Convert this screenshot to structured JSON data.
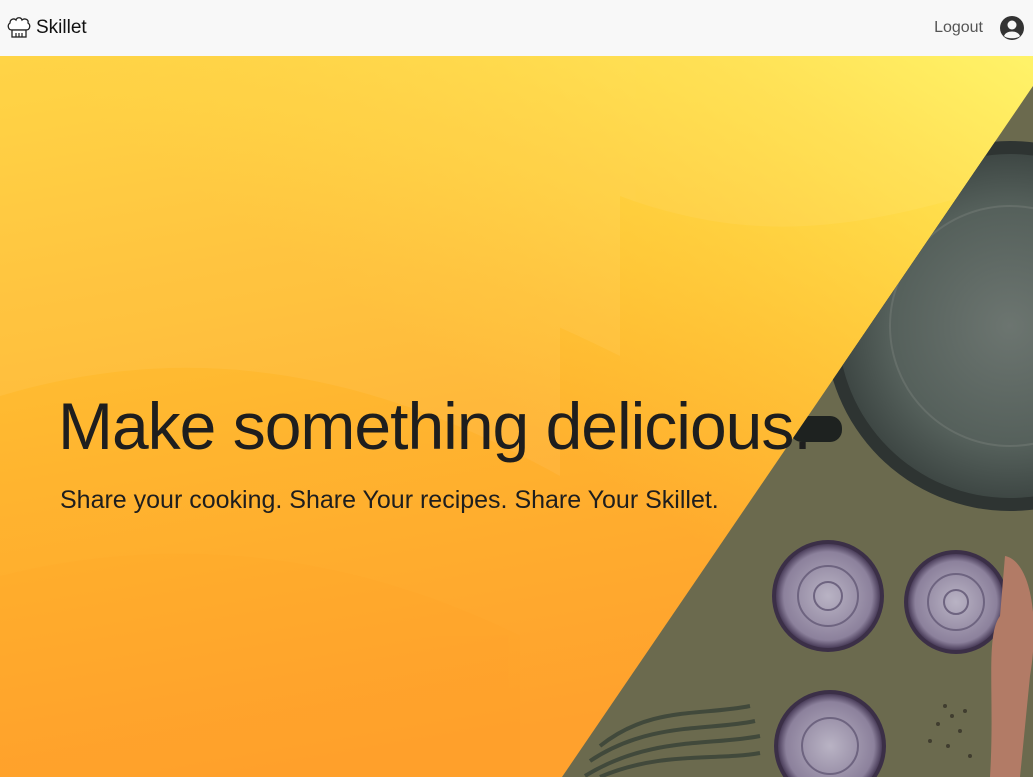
{
  "app": {
    "brand_name": "Skillet",
    "brand_icon": "chef-hat-icon"
  },
  "nav": {
    "logout_label": "Logout",
    "avatar_icon": "user-avatar-icon"
  },
  "hero": {
    "title": "Make something delicious.",
    "subtitle": "Share your cooking. Share Your recipes. Share Your Skillet.",
    "photo_subject": "pan-onions-pasta-photo"
  },
  "colors": {
    "navbar_bg": "#f8f8f8",
    "hero_gradient_top": "#ffd23a",
    "hero_gradient_bottom": "#ffa12d",
    "text_dark": "#1e1e1e"
  }
}
